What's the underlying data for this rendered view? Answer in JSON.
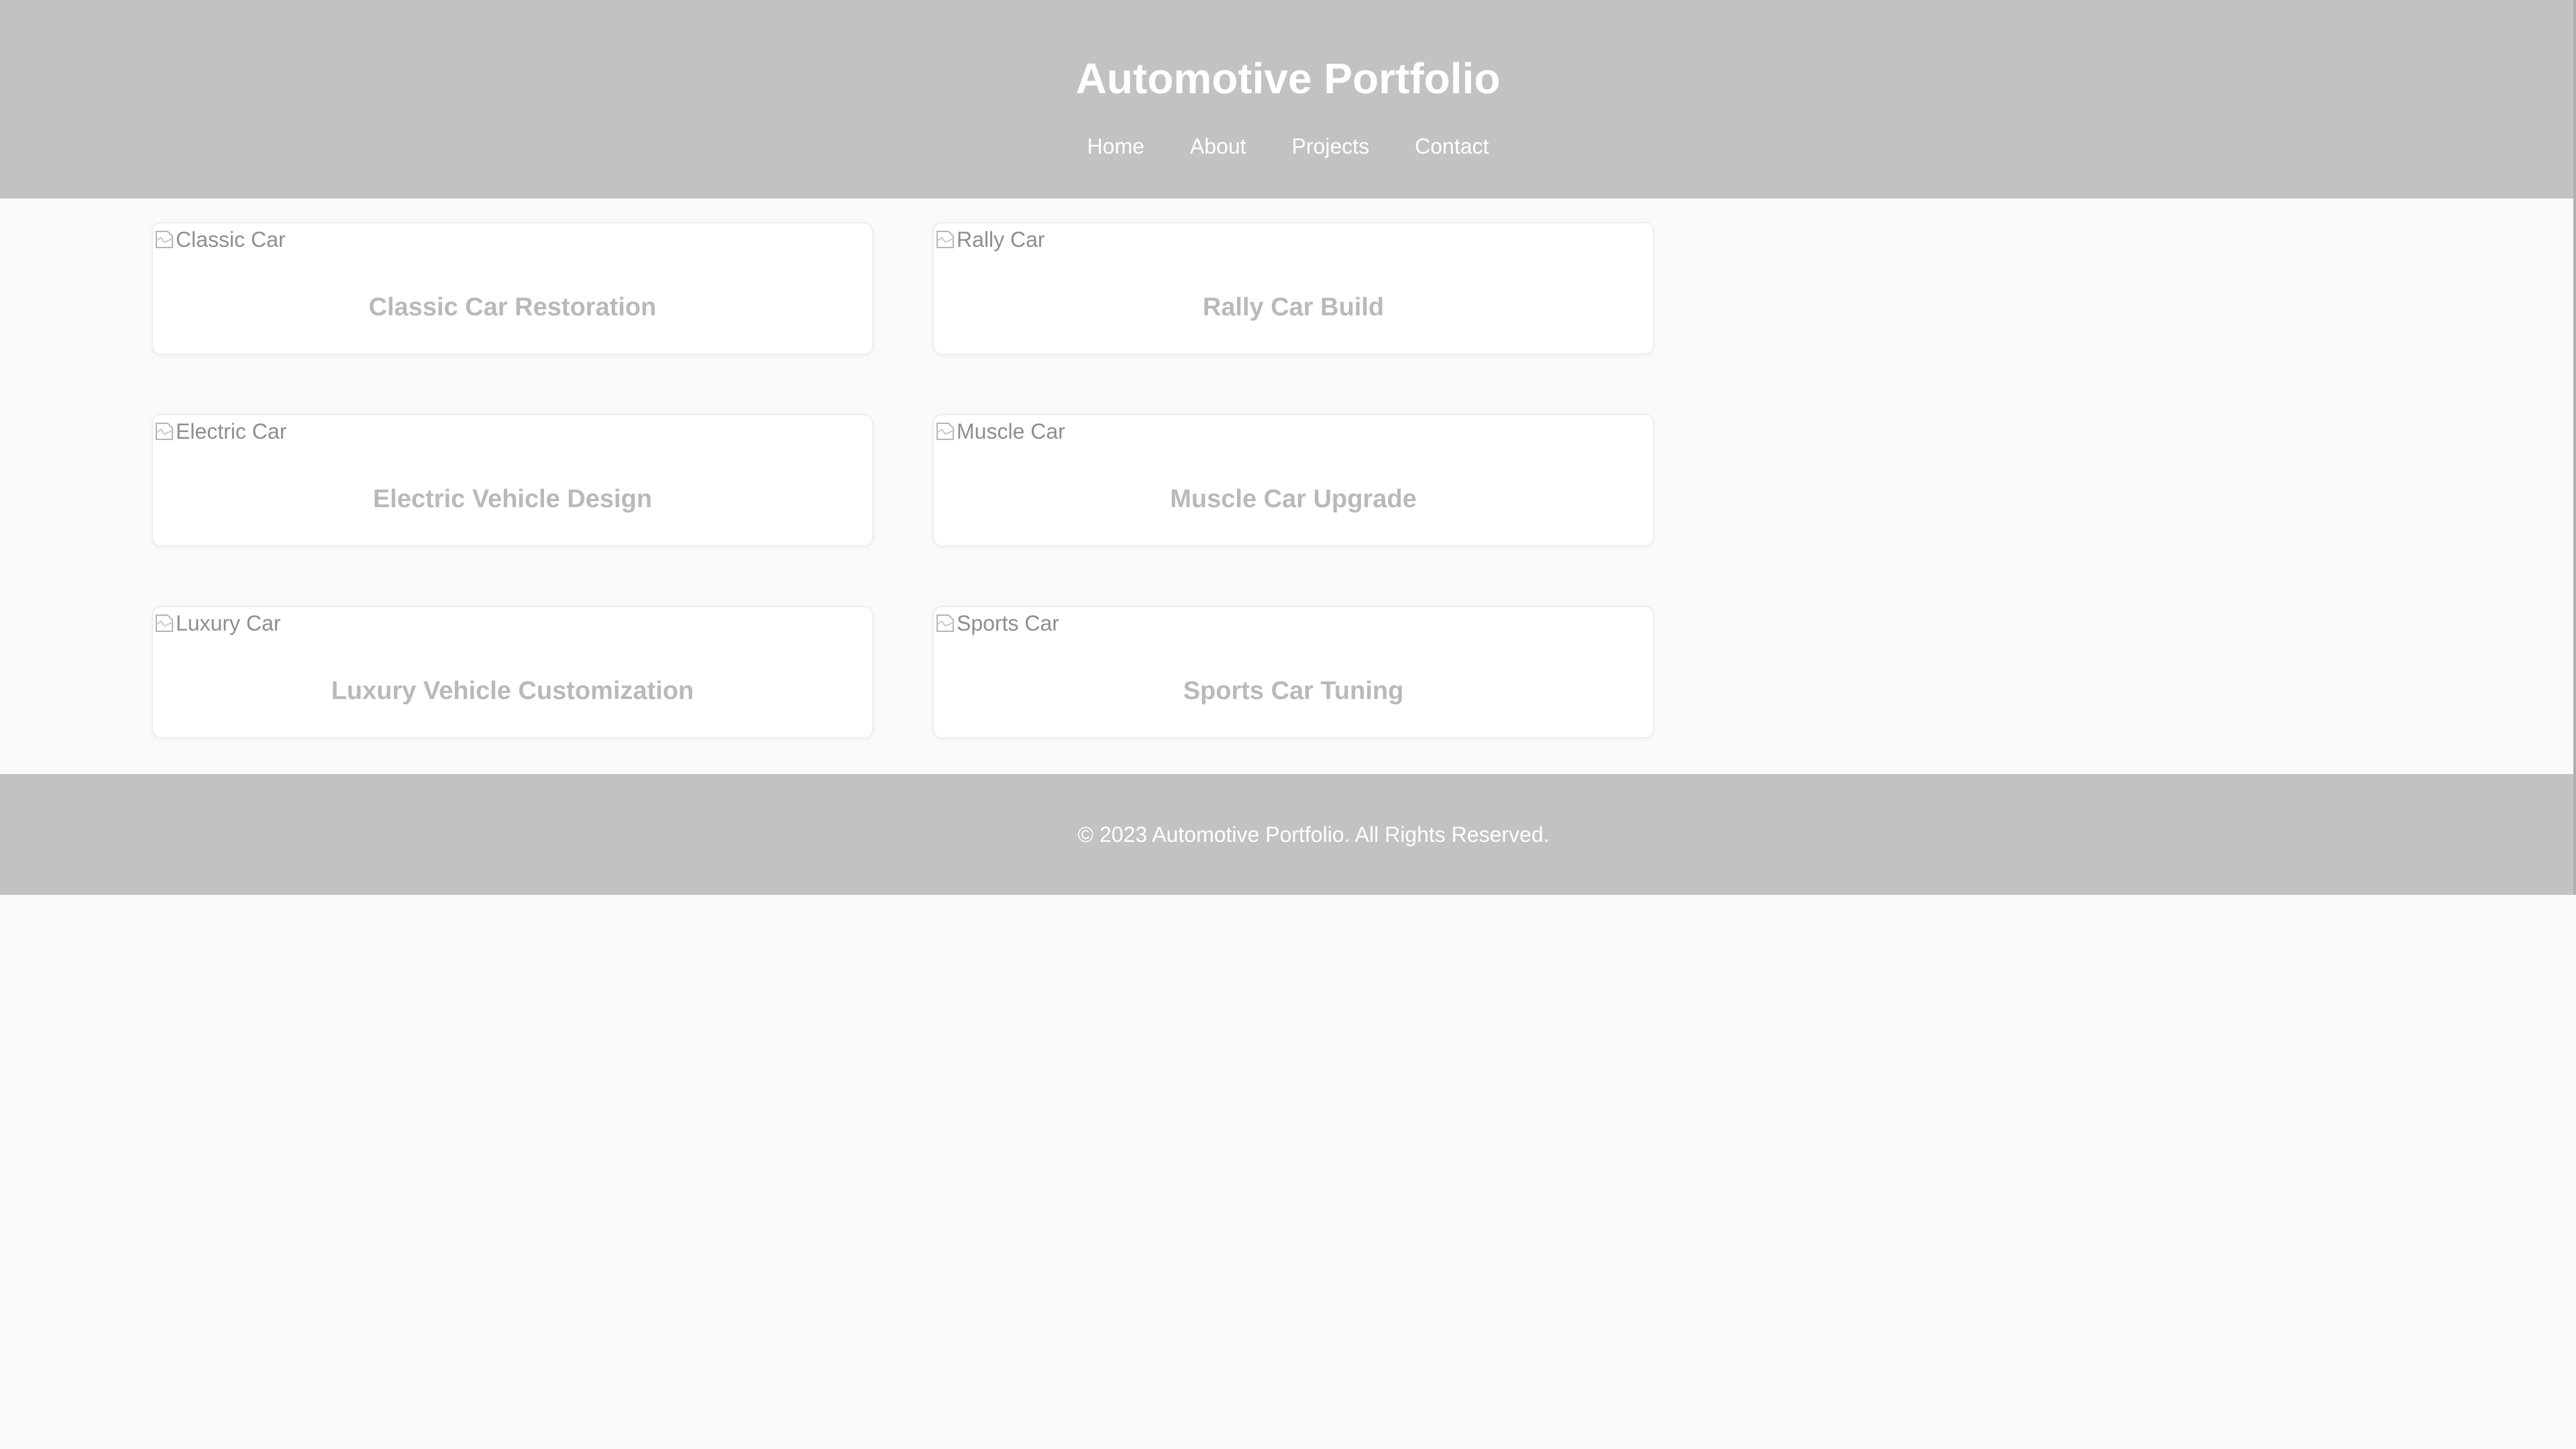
{
  "header": {
    "title": "Automotive Portfolio",
    "nav": [
      {
        "label": "Home"
      },
      {
        "label": "About"
      },
      {
        "label": "Projects"
      },
      {
        "label": "Contact"
      }
    ]
  },
  "projects": [
    {
      "image_alt": "Classic Car",
      "title": "Classic Car Restoration"
    },
    {
      "image_alt": "Rally Car",
      "title": "Rally Car Build"
    },
    {
      "image_alt": "Electric Car",
      "title": "Electric Vehicle Design"
    },
    {
      "image_alt": "Muscle Car",
      "title": "Muscle Car Upgrade"
    },
    {
      "image_alt": "Luxury Car",
      "title": "Luxury Vehicle Customization"
    },
    {
      "image_alt": "Sports Car",
      "title": "Sports Car Tuning"
    }
  ],
  "footer": {
    "text": "© 2023 Automotive Portfolio. All Rights Reserved."
  },
  "colors": {
    "header_bg": "#c2c2c2",
    "page_bg": "#fafafa",
    "card_title": "#b9b9b9"
  }
}
